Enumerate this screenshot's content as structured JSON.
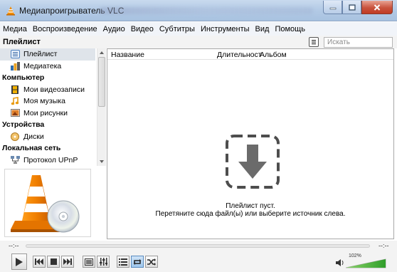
{
  "window": {
    "title": "Медиапроигрыватель VLC",
    "accent": "#f28c00"
  },
  "menu": [
    "Медиа",
    "Воспроизведение",
    "Аудио",
    "Видео",
    "Субтитры",
    "Инструменты",
    "Вид",
    "Помощь"
  ],
  "header": {
    "label": "Плейлист",
    "search_placeholder": "Искать"
  },
  "sidebar": {
    "playlist": "Плейлист",
    "library": "Медиатека",
    "computer": "Компьютер",
    "videos": "Мои видеозаписи",
    "music": "Моя музыка",
    "pictures": "Мои рисунки",
    "devices": "Устройства",
    "discs": "Диски",
    "network": "Локальная сеть",
    "upnp": "Протокол UPnP"
  },
  "playlist": {
    "col_name": "Название",
    "col_duration": "Длительност",
    "col_album": "Альбом",
    "empty_line1": "Плейлист пуст.",
    "empty_line2": "Перетяните сюда файл(ы) или выберите источник слева."
  },
  "seek": {
    "elapsed": "--:--",
    "remaining": "--:--"
  },
  "volume": {
    "label": "102%",
    "level": 1.02
  }
}
